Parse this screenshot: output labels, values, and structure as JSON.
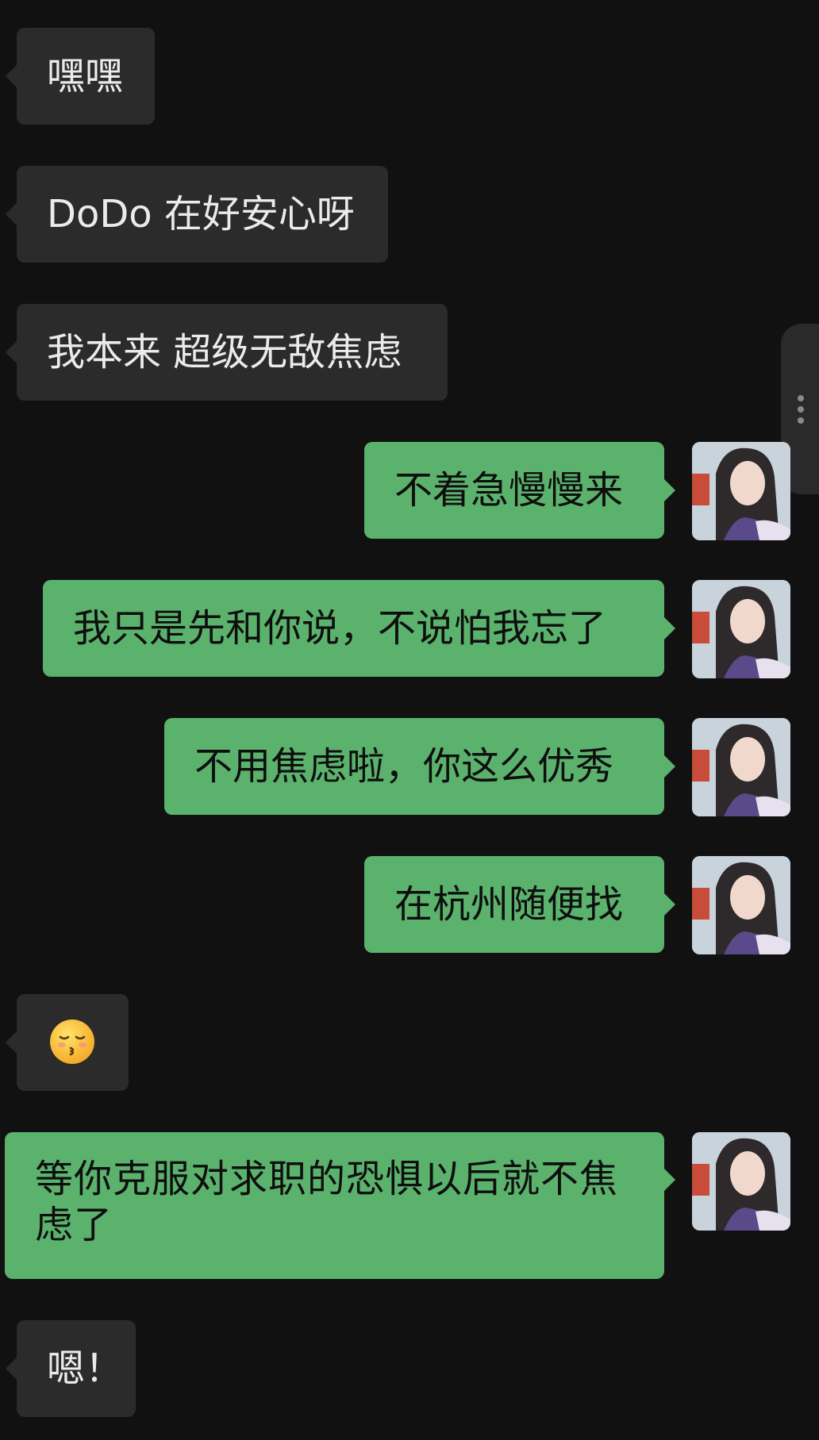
{
  "messages": [
    {
      "direction": "incoming",
      "text": "嘿嘿"
    },
    {
      "direction": "incoming",
      "text": "DoDo 在好安心呀"
    },
    {
      "direction": "incoming",
      "text": "我本来 超级无敌焦虑"
    },
    {
      "direction": "outgoing",
      "text": "不着急慢慢来"
    },
    {
      "direction": "outgoing",
      "text": "我只是先和你说，不说怕我忘了"
    },
    {
      "direction": "outgoing",
      "text": "不用焦虑啦，你这么优秀"
    },
    {
      "direction": "outgoing",
      "text": "在杭州随便找"
    },
    {
      "direction": "incoming",
      "emoji": "kissing-face-with-closed-eyes"
    },
    {
      "direction": "outgoing",
      "text": "等你克服对求职的恐惧以后就不焦虑了"
    },
    {
      "direction": "incoming",
      "text": "嗯！"
    }
  ],
  "colors": {
    "background": "#111111",
    "incoming_bubble": "#2b2b2b",
    "outgoing_bubble": "#5bb26d",
    "incoming_text": "#ebebeb",
    "outgoing_text": "#0e0e0e"
  },
  "icons": {
    "side_handle": "more-vertical-icon",
    "avatar": "user-avatar-photo"
  }
}
